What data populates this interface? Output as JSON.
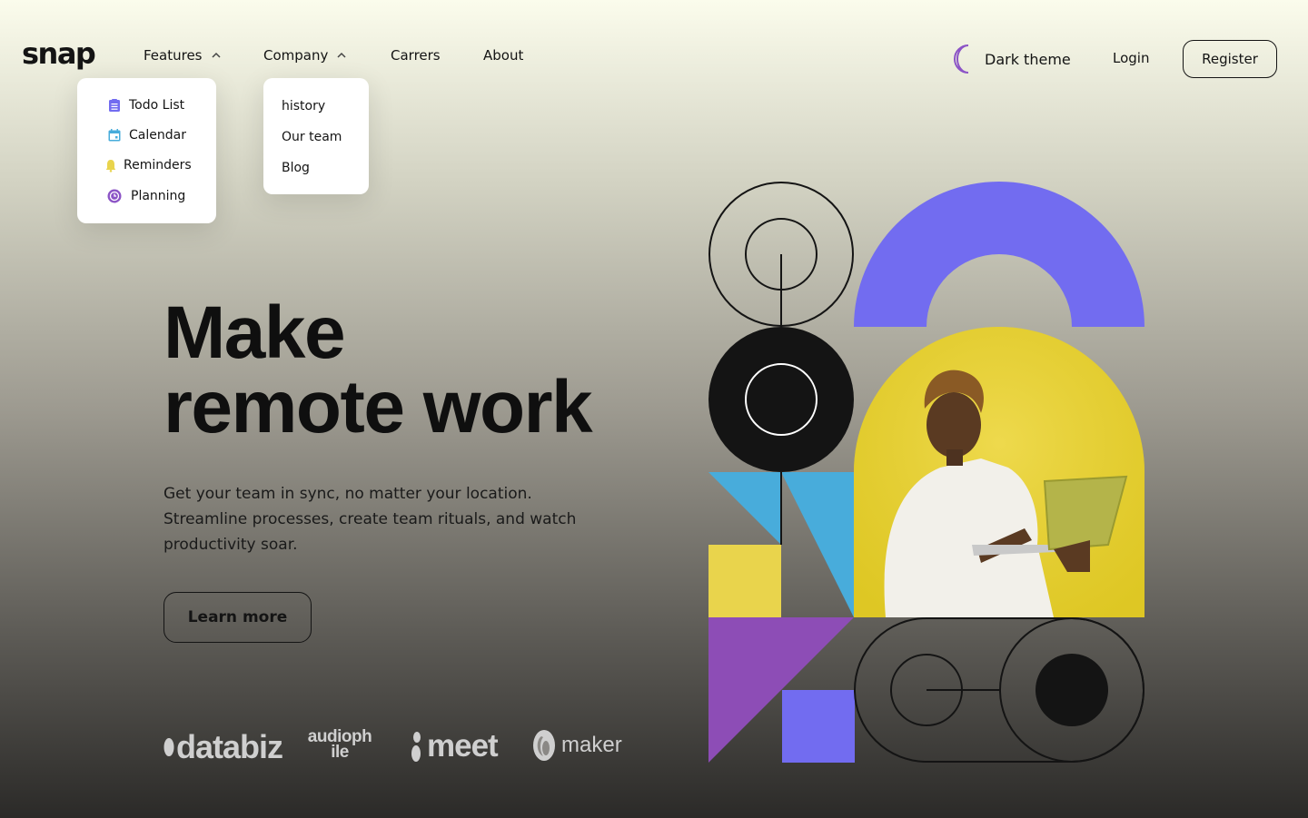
{
  "brand": {
    "logo": "snap"
  },
  "nav": {
    "features": {
      "label": "Features",
      "items": [
        {
          "label": "Todo List",
          "icon": "todo-list-icon"
        },
        {
          "label": "Calendar",
          "icon": "calendar-icon"
        },
        {
          "label": "Reminders",
          "icon": "bell-icon"
        },
        {
          "label": "Planning",
          "icon": "planning-clock-icon"
        }
      ]
    },
    "company": {
      "label": "Company",
      "items": [
        {
          "label": "history"
        },
        {
          "label": "Our team"
        },
        {
          "label": "Blog"
        }
      ]
    },
    "careers": "Carrers",
    "about": "About"
  },
  "header": {
    "theme_label": "Dark theme",
    "login": "Login",
    "register": "Register"
  },
  "hero": {
    "title_line1": "Make",
    "title_line2": "remote work",
    "description": "Get your team in sync, no matter your location. Streamline processes, create team rituals, and watch productivity soar.",
    "cta": "Learn more"
  },
  "clients": [
    "databiz",
    "audiophile",
    "meet",
    "maker"
  ],
  "colors": {
    "accent_blue": "#726cf0",
    "cyan": "#48acdb",
    "yellow": "#e9d44c",
    "purple": "#8d4db6",
    "moon": "#8c54c6",
    "dark": "#141414"
  }
}
